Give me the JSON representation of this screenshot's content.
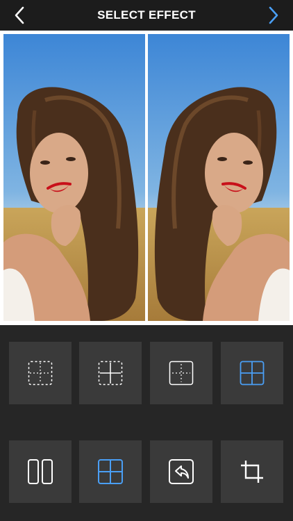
{
  "header": {
    "title": "SELECT EFFECT",
    "back_icon": "chevron-left-icon",
    "next_icon": "chevron-right-icon",
    "next_color": "#4a9ff5"
  },
  "preview": {
    "layout": "mirror-vertical-split",
    "panels": 2
  },
  "toolbar": {
    "row1": [
      {
        "icon": "grid-dashed-outer-icon"
      },
      {
        "icon": "grid-dashed-center-icon"
      },
      {
        "icon": "grid-center-dashed-icon"
      },
      {
        "icon": "grid-solid-icon",
        "selected": true
      }
    ],
    "row2": [
      {
        "icon": "split-two-columns-icon"
      },
      {
        "icon": "grid-solid-icon",
        "selected": true
      },
      {
        "icon": "undo-share-icon"
      },
      {
        "icon": "crop-icon"
      }
    ]
  },
  "colors": {
    "accent": "#4a9ff5",
    "background": "#262626",
    "tile": "#3a3a3a"
  }
}
